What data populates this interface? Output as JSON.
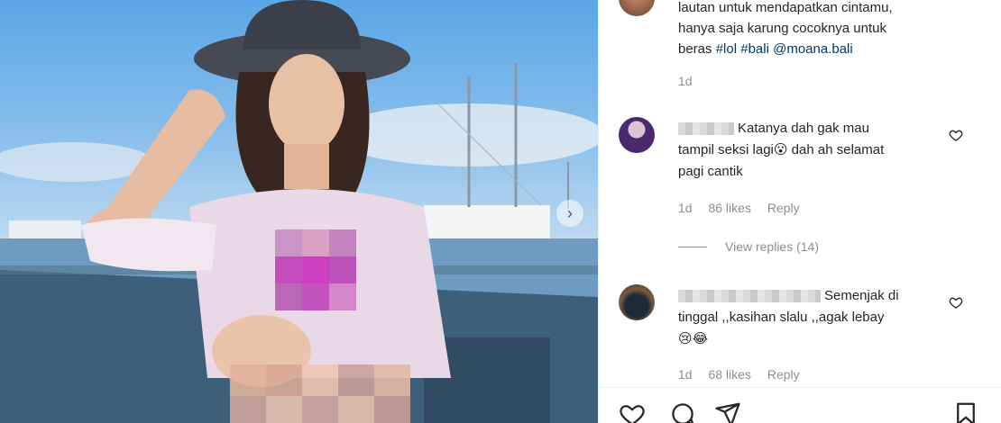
{
  "post": {
    "caption_lines": [
      "lautan untuk mendapatkan cintamu,",
      "hanya saja karung cocoknya untuk"
    ],
    "caption_prefix": "beras ",
    "hashtag_1": "#lol",
    "hashtag_2": "#bali",
    "mention": "@moana.bali",
    "time": "1d"
  },
  "comments": [
    {
      "line1": "Katanya dah gak mau",
      "line2": "tampil seksi lagi😮 dah ah selamat",
      "line3": "pagi cantik",
      "time": "1d",
      "likes": "86 likes",
      "reply": "Reply",
      "view_replies": "View replies (14)"
    },
    {
      "line1": "Semenjak di",
      "line2": "tinggal ,,kasihan slalu ,,agak lebay",
      "line3": "😢😂",
      "time": "1d",
      "likes": "68 likes",
      "reply": "Reply"
    }
  ],
  "icons": {
    "carousel_next": "chevron-right-icon",
    "like": "heart-icon",
    "comment": "comment-icon",
    "share": "send-icon",
    "save": "bookmark-icon"
  },
  "colors": {
    "text": "#262626",
    "muted": "#8e8e8e",
    "link": "#00376b"
  }
}
